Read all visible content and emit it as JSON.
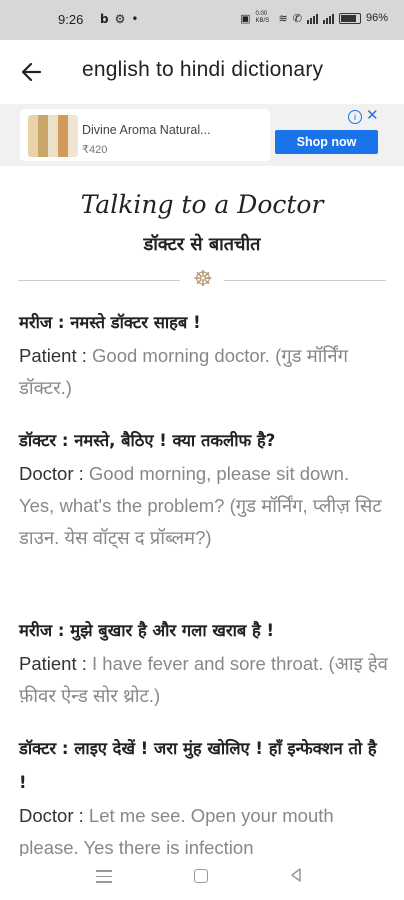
{
  "status_bar": {
    "time": "9:26",
    "left_icons": [
      "b-icon",
      "settings-icon",
      "dot-icon"
    ],
    "data_rate": "0.00 KB/S",
    "battery": "96%"
  },
  "app_bar": {
    "title": "english to hindi dictionary"
  },
  "ad": {
    "name": "Divine Aroma Natural...",
    "price": "₹420",
    "button": "Shop now",
    "info_glyph": "i",
    "close_glyph": "✕",
    "accent": "#1a73e8"
  },
  "topic": {
    "title": "Talking to a Doctor",
    "subtitle": "डॉक्टर से बातचीत",
    "divider_glyph": "☸"
  },
  "dialogue": [
    {
      "hindi": "मरीज : नमस्ते डॉक्टर साहब !",
      "speaker": "Patient :",
      "english": "Good morning doctor. (गुड मॉर्निंग डॉक्टर.)"
    },
    {
      "hindi": "डॉक्टर : नमस्ते, बैठिए ! क्या तकलीफ है?",
      "speaker": "Doctor :",
      "english": "Good morning, please sit down. Yes, what's the problem? (गुड मॉर्निंग, प्लीज़ सिट डाउन. येस वॉट्स द प्रॉब्लम?)"
    },
    {
      "hindi": "मरीज : मुझे बुखार है और गला खराब है !",
      "speaker": "Patient :",
      "english": "I have fever and sore throat. (आइ हेव फ़ीवर ऐन्ड सोर थ्रोट.)"
    },
    {
      "hindi": "डॉक्टर : लाइए देखें ! जरा मुंह खोलिए ! हाँ इन्फेक्शन तो है !",
      "speaker": "Doctor :",
      "english": "Let me see. Open your mouth please. Yes there is infection"
    }
  ],
  "colors": {
    "status_bar_bg": "#d7d7d7",
    "ad_strip_bg": "#f1f1f1",
    "english_text": "#888888",
    "divider_icon": "#b59b74"
  }
}
